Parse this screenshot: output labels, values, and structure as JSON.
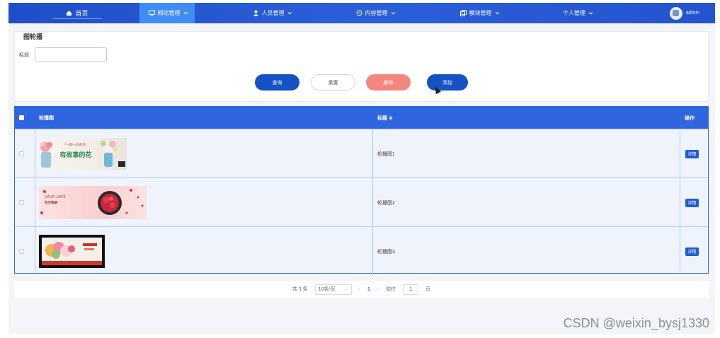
{
  "nav": {
    "home": "首页",
    "items": [
      {
        "label": "网站管理",
        "icon": "monitor-icon"
      },
      {
        "label": "人员管理",
        "icon": "user-icon"
      },
      {
        "label": "内容管理",
        "icon": "chat-icon"
      },
      {
        "label": "模块管理",
        "icon": "copy-icon"
      },
      {
        "label": "个人管理",
        "icon": ""
      }
    ],
    "username": "admin",
    "colors": {
      "bar": "#2454cf",
      "active": "#3f8cf5"
    }
  },
  "breadcrumb": "图轮播",
  "search": {
    "label": "标题",
    "value": "",
    "placeholder": ""
  },
  "buttons": {
    "query": "查询",
    "reset": "重置",
    "delete": "删除",
    "add": "添加"
  },
  "table": {
    "headers": {
      "image": "轮播图",
      "title": "标题 ≑",
      "actions": "操作"
    },
    "rows": [
      {
        "title": "轮播图1",
        "action": "详情",
        "thumb_text": "有故事的花",
        "thumb_sub": "「一期一会系列」"
      },
      {
        "title": "轮播图2",
        "action": "详情",
        "thumb_text": "DAISY LOVE",
        "thumb_sub": "花艺物语"
      },
      {
        "title": "轮播图3",
        "action": "详情",
        "thumb_text": "",
        "thumb_sub": ""
      }
    ]
  },
  "pagination": {
    "total": "共 3 条",
    "page_size": "10条/页",
    "current": "1",
    "goto_label": "前往",
    "goto_value": "1",
    "page_suffix": "页"
  },
  "watermark": "CSDN @weixin_bysj1330"
}
